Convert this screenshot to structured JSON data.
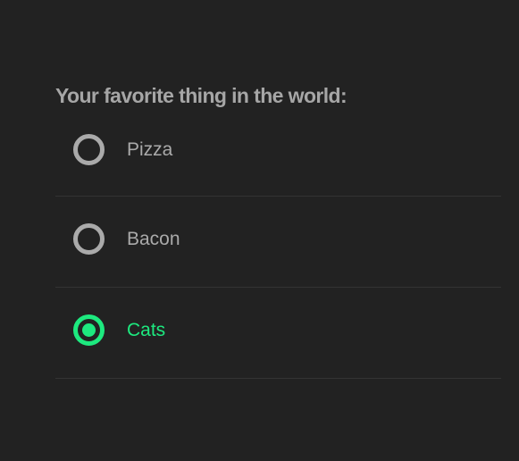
{
  "question": "Your favorite thing in the world:",
  "options": [
    {
      "label": "Pizza",
      "checked": false
    },
    {
      "label": "Bacon",
      "checked": false
    },
    {
      "label": "Cats",
      "checked": true
    }
  ],
  "colors": {
    "background": "#222222",
    "text": "#aaaaaa",
    "accent": "#1de97f",
    "divider": "#333333"
  },
  "icons": {
    "radio_unchecked": "radio-unchecked-icon",
    "radio_checked": "radio-checked-icon"
  }
}
